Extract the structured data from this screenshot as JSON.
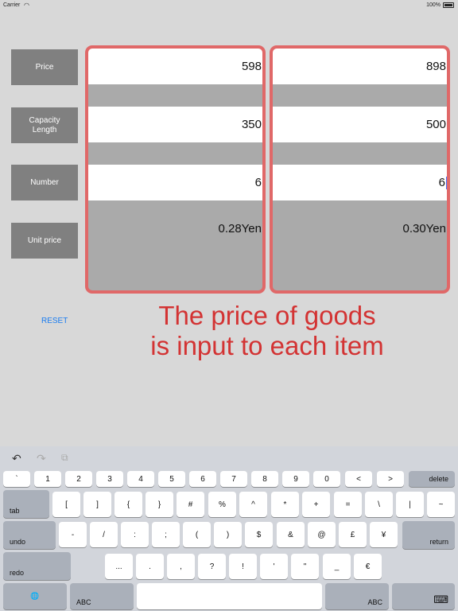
{
  "statusbar": {
    "carrier": "Carrier",
    "wifi_icon": "wifi-icon",
    "battery": "100%"
  },
  "labels": [
    "Price",
    "Capacity\nLength",
    "Number",
    "Unit price"
  ],
  "item1": {
    "price": "598",
    "capacity": "350",
    "number": "6",
    "unit_price": "0.28Yen"
  },
  "item2": {
    "price": "898",
    "capacity": "500",
    "number": "6",
    "unit_price": "0.30Yen"
  },
  "reset_label": "RESET",
  "callout": {
    "line1": "The price of goods",
    "line2": "is input to each item"
  },
  "keyboard": {
    "toolbar": {
      "undo_icon": "↶",
      "redo_icon": "↷",
      "paste_icon": "⧉"
    },
    "row1": [
      "`",
      "1",
      "2",
      "3",
      "4",
      "5",
      "6",
      "7",
      "8",
      "9",
      "0",
      "<",
      ">"
    ],
    "delete": "delete",
    "tab": "tab",
    "row2": [
      "[",
      "]",
      "{",
      "}",
      "#",
      "%",
      "^",
      "*",
      "+",
      "=",
      "\\",
      "|",
      "~"
    ],
    "undo": "undo",
    "row3": [
      "-",
      "/",
      ":",
      ";",
      "(",
      ")",
      "$",
      "&",
      "@",
      "£",
      "¥"
    ],
    "return": "return",
    "redo": "redo",
    "row4": [
      "...",
      ".",
      ",",
      "?",
      "!",
      "'",
      "\"",
      "_",
      "€"
    ],
    "globe_icon": "🌐",
    "abc_left": "ABC",
    "abc_right": "ABC",
    "hide_keyboard_icon": "⌨"
  },
  "colors": {
    "frame": "#e06868",
    "callout": "#d33333",
    "reset": "#1a7cf0"
  }
}
